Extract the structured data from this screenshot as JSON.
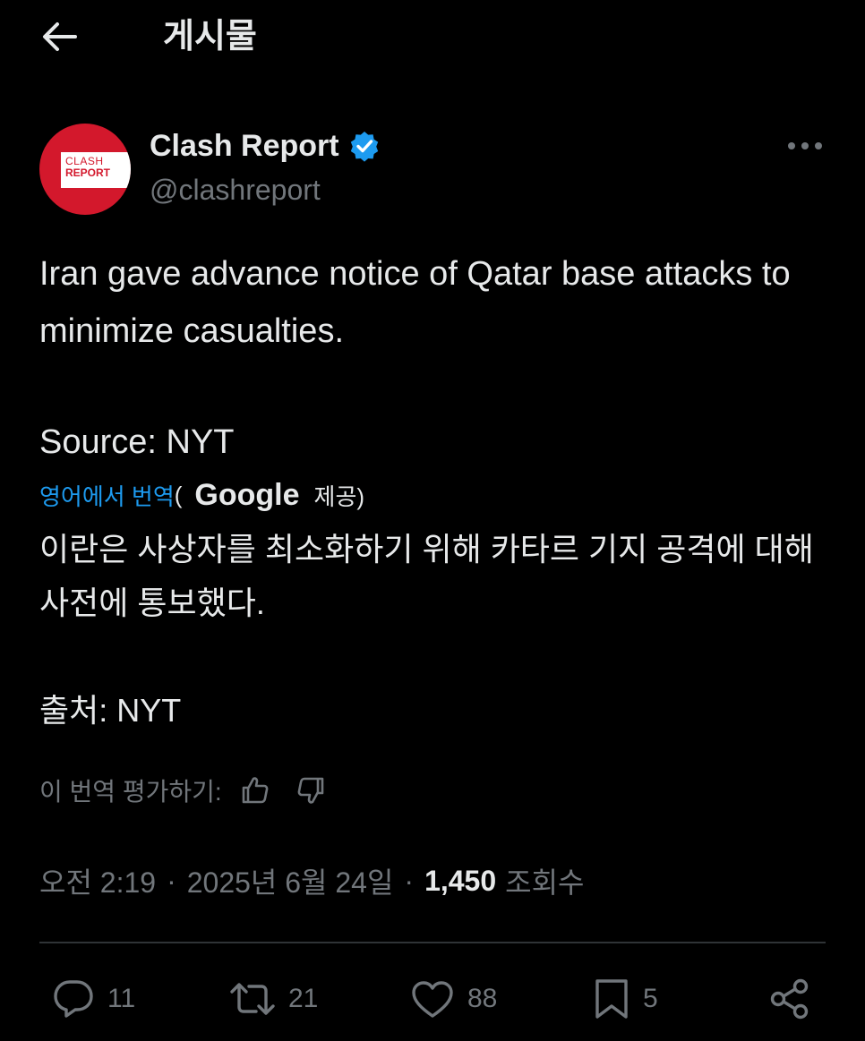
{
  "header": {
    "title": "게시물"
  },
  "author": {
    "display_name": "Clash Report",
    "handle": "@clashreport",
    "avatar_text_line1": "CLASH",
    "avatar_text_line2": "REPORT"
  },
  "tweet": {
    "text_line1": "Iran gave advance notice of Qatar base attacks to minimize casualties.",
    "source": "Source: NYT"
  },
  "translation": {
    "link_label": "영어에서 번역",
    "open_paren": "(",
    "provider": "Google",
    "provided_label": "제공)",
    "text_line1": "이란은 사상자를 최소화하기 위해 카타르 기지 공격에 대해 사전에 통보했다.",
    "source": "출처: NYT",
    "rate_label": "이 번역 평가하기:"
  },
  "meta": {
    "time": "오전 2:19",
    "separator": "·",
    "date": "2025년 6월 24일",
    "views_count": "1,450",
    "views_label": "조회수"
  },
  "actions": {
    "replies": "11",
    "reposts": "21",
    "likes": "88",
    "bookmarks": "5"
  },
  "colors": {
    "background": "#000000",
    "text": "#e7e9ea",
    "secondary": "#71767b",
    "accent": "#1d9bf0",
    "brand_red": "#d3182c"
  }
}
